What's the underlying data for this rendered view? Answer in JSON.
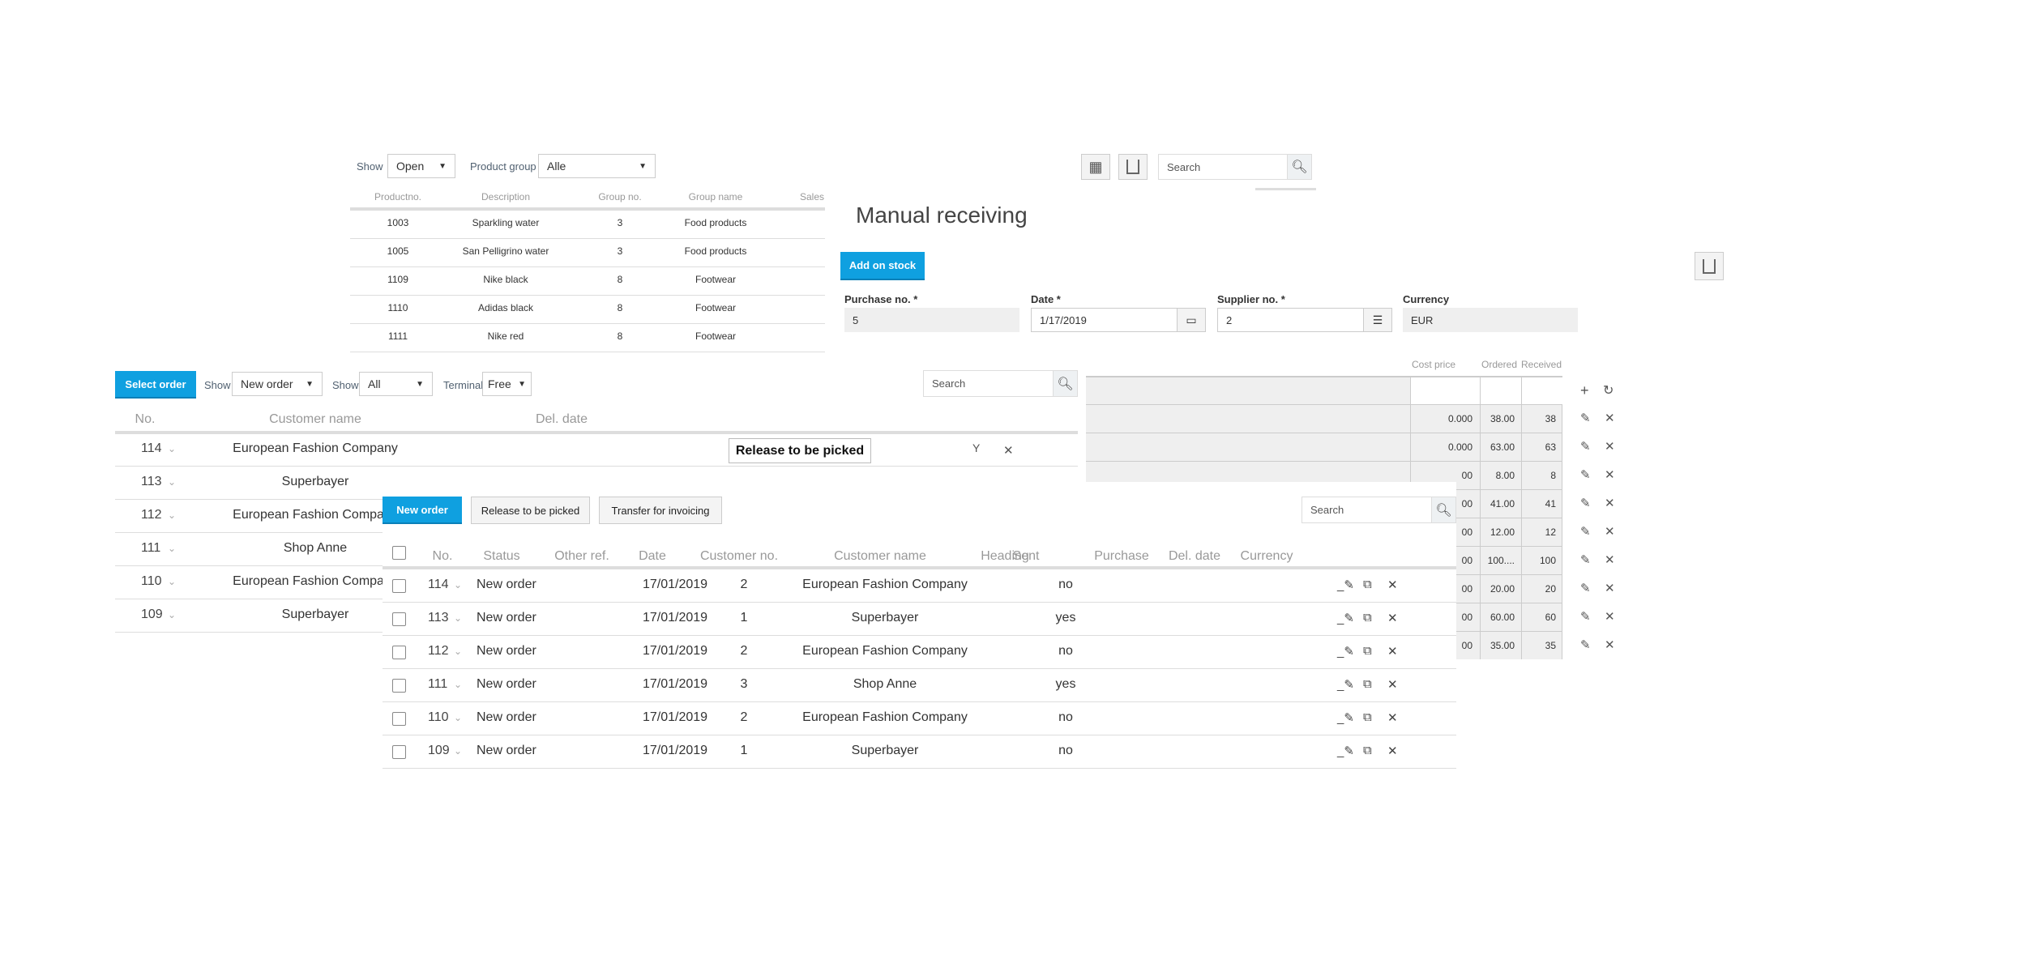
{
  "product_panel": {
    "show_label": "Show",
    "show_value": "Open",
    "group_label": "Product group",
    "group_value": "Alle",
    "columns": [
      "Productno.",
      "Description",
      "Group no.",
      "Group name",
      "Sales"
    ],
    "rows": [
      [
        "1003",
        "Sparkling water",
        "3",
        "Food products"
      ],
      [
        "1005",
        "San Pelligrino water",
        "3",
        "Food products"
      ],
      [
        "1109",
        "Nike black",
        "8",
        "Footwear"
      ],
      [
        "1110",
        "Adidas black",
        "8",
        "Footwear"
      ],
      [
        "1111",
        "Nike red",
        "8",
        "Footwear"
      ]
    ]
  },
  "receiving": {
    "title": "Manual receiving",
    "search_placeholder": "Search",
    "add_button": "Add on stock",
    "fields": [
      {
        "label": "Purchase no. *",
        "value": "5"
      },
      {
        "label": "Date *",
        "value": "1/17/2019"
      },
      {
        "label": "Supplier no. *",
        "value": "2"
      },
      {
        "label": "Currency",
        "value": "EUR"
      }
    ],
    "columns": [
      "Cost price",
      "Ordered",
      "Received"
    ],
    "rows": [
      [
        "0.000",
        "38.00",
        "38"
      ],
      [
        "0.000",
        "63.00",
        "63"
      ],
      [
        "00",
        "8.00",
        "8"
      ],
      [
        "00",
        "41.00",
        "41"
      ],
      [
        "00",
        "12.00",
        "12"
      ],
      [
        "00",
        "100....",
        "100"
      ],
      [
        "00",
        "20.00",
        "20"
      ],
      [
        "00",
        "60.00",
        "60"
      ],
      [
        "00",
        "35.00",
        "35"
      ]
    ]
  },
  "picking": {
    "select_button": "Select order",
    "show_label": "Show",
    "show_value": "New order",
    "show2_label": "Show",
    "show2_value": "All",
    "terminal_label": "Terminal",
    "terminal_value": "Free",
    "search_placeholder": "Search",
    "columns": [
      "No.",
      "Customer name",
      "Del. date"
    ],
    "release_button": "Release to be picked",
    "rows": [
      [
        "114",
        "European Fashion Company"
      ],
      [
        "113",
        "Superbayer"
      ],
      [
        "112",
        "European Fashion Company"
      ],
      [
        "111",
        "Shop Anne"
      ],
      [
        "110",
        "European Fashion Company"
      ],
      [
        "109",
        "Superbayer"
      ]
    ]
  },
  "orders": {
    "new_button": "New order",
    "release_button": "Release to be picked",
    "transfer_button": "Transfer for invoicing",
    "search_placeholder": "Search",
    "columns": [
      "No.",
      "Status",
      "Other ref.",
      "Date",
      "Customer no.",
      "Customer name",
      "Heading",
      "Sent",
      "Purchase",
      "Del. date",
      "Currency"
    ],
    "rows": [
      {
        "no": "114",
        "status": "New order",
        "date": "17/01/2019",
        "cust_no": "2",
        "cust_name": "European Fashion Company",
        "sent": "no"
      },
      {
        "no": "113",
        "status": "New order",
        "date": "17/01/2019",
        "cust_no": "1",
        "cust_name": "Superbayer",
        "sent": "yes"
      },
      {
        "no": "112",
        "status": "New order",
        "date": "17/01/2019",
        "cust_no": "2",
        "cust_name": "European Fashion Company",
        "sent": "no"
      },
      {
        "no": "111",
        "status": "New order",
        "date": "17/01/2019",
        "cust_no": "3",
        "cust_name": "Shop Anne",
        "sent": "yes"
      },
      {
        "no": "110",
        "status": "New order",
        "date": "17/01/2019",
        "cust_no": "2",
        "cust_name": "European Fashion Company",
        "sent": "no"
      },
      {
        "no": "109",
        "status": "New order",
        "date": "17/01/2019",
        "cust_no": "1",
        "cust_name": "Superbayer",
        "sent": "no"
      }
    ]
  },
  "colors": {
    "accent": "#0fa0e0"
  }
}
